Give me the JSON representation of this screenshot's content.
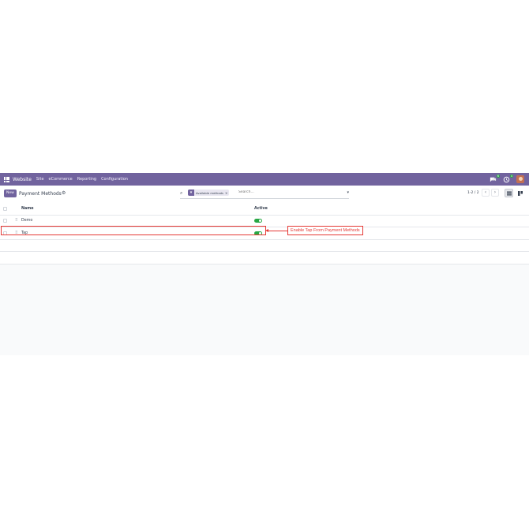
{
  "navbar": {
    "app_name": "Website",
    "menu": [
      "Site",
      "eCommerce",
      "Reporting",
      "Configuration"
    ],
    "chat_badge": "6",
    "activity_badge": "4"
  },
  "control": {
    "new_label": "New",
    "title": "Payment Methods",
    "facet_label": "Available methods",
    "facet_remove": "×",
    "search_placeholder": "Search...",
    "pager": "1-2 / 2"
  },
  "list": {
    "columns": [
      "Name",
      "Active"
    ],
    "rows": [
      {
        "name": "Demo",
        "active": true
      },
      {
        "name": "Tap",
        "active": true
      }
    ]
  },
  "annotation": {
    "text": "Enable Tap  From Payment Methods",
    "color": "#e53935"
  },
  "colors": {
    "brand": "#71639e",
    "toggle_on": "#28a745"
  }
}
